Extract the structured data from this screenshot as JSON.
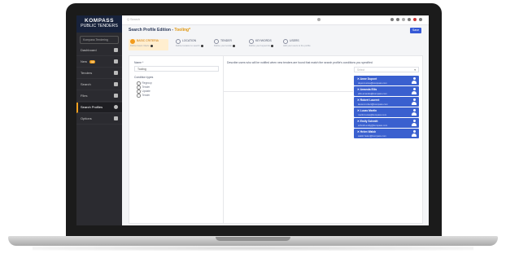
{
  "app": {
    "logo_line1": "KOMPASS",
    "logo_line2": "PUBLIC TENDERS"
  },
  "sidebar": {
    "select_label": "Kompass Tendering",
    "items": [
      {
        "label": "Dashboard",
        "badge": ""
      },
      {
        "label": "New",
        "badge": "12"
      },
      {
        "label": "Tenders",
        "badge": ""
      },
      {
        "label": "Search",
        "badge": ""
      },
      {
        "label": "Files",
        "badge": ""
      },
      {
        "label": "Search Profiles",
        "badge": ""
      },
      {
        "label": "Options",
        "badge": ""
      }
    ],
    "active_index": 5
  },
  "topbar": {
    "search_placeholder": "Q Search"
  },
  "main": {
    "title_prefix": "Search Profile Edition - ",
    "title_name": "Tooling*",
    "save_label": "Save",
    "steps": [
      {
        "label": "BASIC CRITERIA",
        "sub": "Define basic criteria"
      },
      {
        "label": "LOCATION",
        "sub": "Define location to search"
      },
      {
        "label": "TENDER",
        "sub": "Define your tender"
      },
      {
        "label": "KEYWORDS",
        "sub": "Define your keywords"
      },
      {
        "label": "USERS",
        "sub": "Add your users to the profile"
      }
    ],
    "name_label": "Name *",
    "name_value": "Tooling",
    "conditions_label": "Condition types",
    "conditions": [
      "Regroup",
      "Tender",
      "Update",
      "Tender"
    ],
    "users_prompt": "Describe users who will be notified when new tenders are found that match the search profile's conditions you specified",
    "user_search_placeholder": "Select",
    "users": [
      {
        "name": "Anne Dupont",
        "email": "dupont.anne@kompass.com"
      },
      {
        "name": "Amanda Ellis",
        "email": "ellis.amanda@kompass.com"
      },
      {
        "name": "Robert Laurent",
        "email": "laurent.robert@kompass.com"
      },
      {
        "name": "Lucas Martin",
        "email": "martin.lucas@kompass.com"
      },
      {
        "name": "Emily Schmitt",
        "email": "schmitt.emily@kompass.com"
      },
      {
        "name": "Helen Walsh",
        "email": "walsh.helen@kompass.com"
      }
    ]
  }
}
